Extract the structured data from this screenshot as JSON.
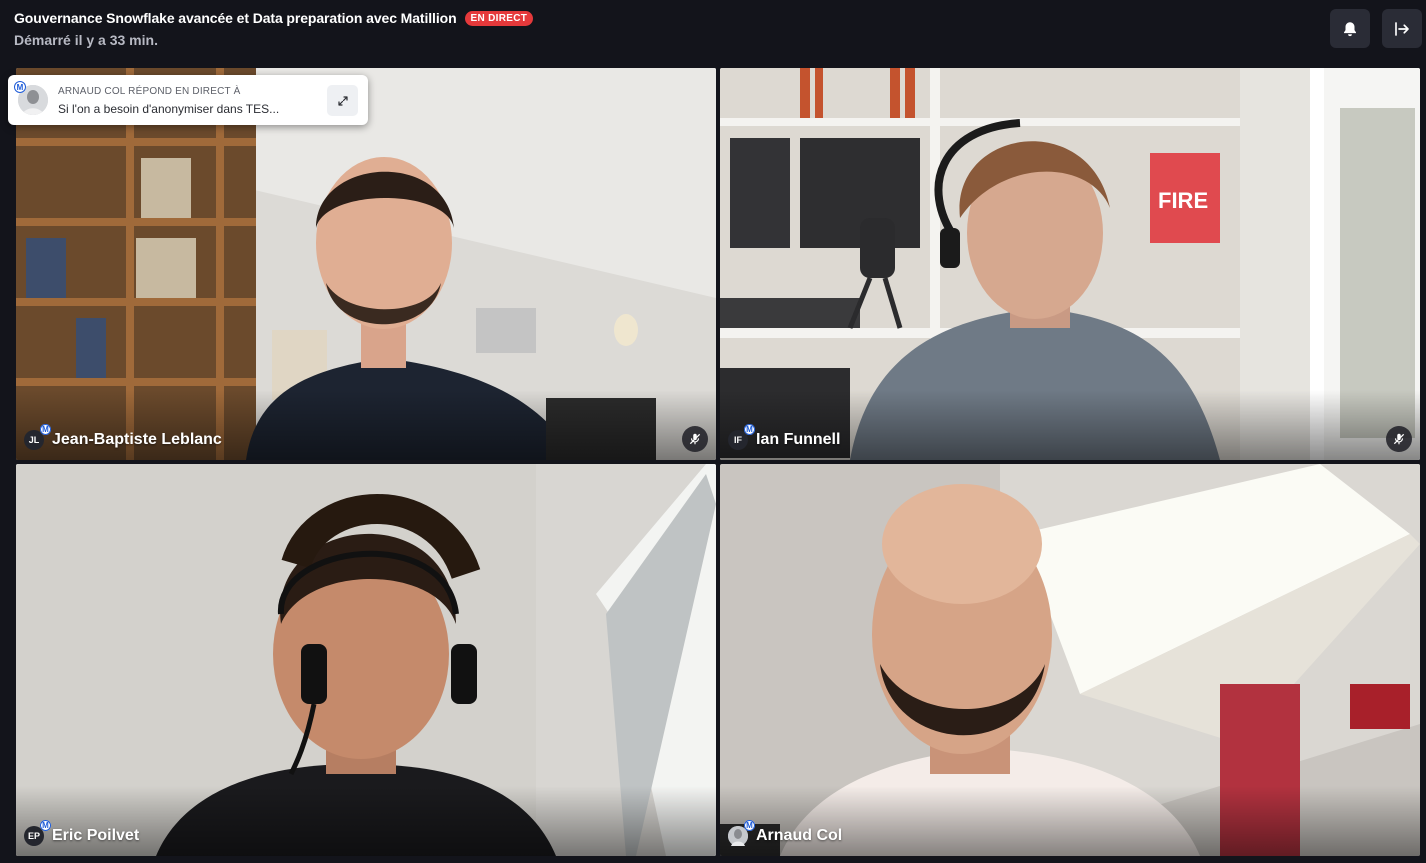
{
  "header": {
    "title": "Gouvernance Snowflake avancée et Data preparation avec Matillion",
    "live_badge": "EN DIRECT",
    "subtitle": "Démarré il y a 33 min.",
    "icons": {
      "notifications": "bell-icon",
      "leave": "exit-icon"
    }
  },
  "reply_card": {
    "label": "ARNAUD COL RÉPOND EN DIRECT À",
    "text": "Si l'on a besoin d'anonymiser dans TES...",
    "badge": "M",
    "icon": "expand-icon"
  },
  "participants": [
    {
      "initials": "JL",
      "name": "Jean-Baptiste Leblanc",
      "badge": "M",
      "muted": true
    },
    {
      "initials": "IF",
      "name": "Ian Funnell",
      "badge": "M",
      "muted": true
    },
    {
      "initials": "EP",
      "name": "Eric Poilvet",
      "badge": "M",
      "muted": false
    },
    {
      "initials": "",
      "name": "Arnaud Col",
      "badge": "M",
      "muted": false
    }
  ],
  "colors": {
    "live": "#e5393b",
    "background": "#13141b",
    "button": "#2a2c36"
  }
}
